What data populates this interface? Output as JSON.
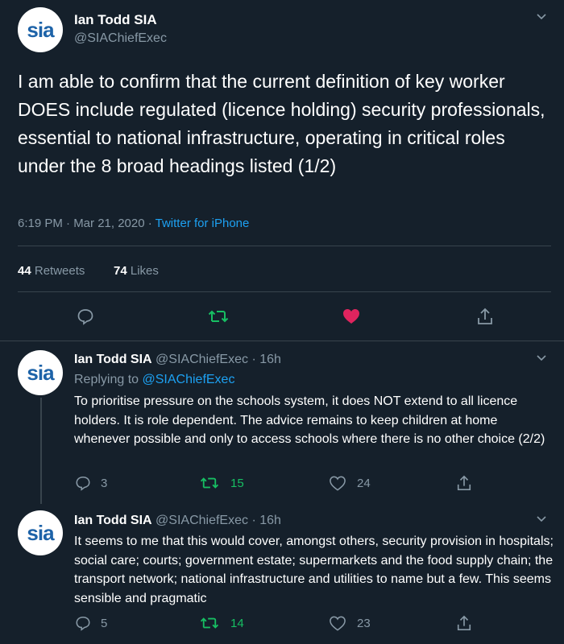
{
  "main_tweet": {
    "author_name": "Ian Todd SIA",
    "handle": "@SIAChiefExec",
    "avatar_text": "sia",
    "text": "I am able to confirm that the current definition of key worker DOES include regulated (licence holding) security professionals, essential to national infrastructure, operating in critical roles under the 8 broad headings listed (1/2)",
    "time": "6:19 PM · Mar 21, 2020 · ",
    "source": "Twitter for iPhone",
    "retweets_count": "44",
    "retweets_label": "Retweets",
    "likes_count": "74",
    "likes_label": "Likes"
  },
  "replies": [
    {
      "author_name": "Ian Todd SIA",
      "handle_time": "@SIAChiefExec · 16h",
      "replying_prefix": "Replying to ",
      "replying_handle": "@SIAChiefExec",
      "text": "To prioritise pressure on the schools system, it does NOT extend to all licence holders. It is role dependent. The advice remains to keep children at home whenever possible and only to access schools where there is no other choice (2/2)",
      "replies": "3",
      "retweets": "15",
      "likes": "24"
    },
    {
      "author_name": "Ian Todd SIA",
      "handle_time": "@SIAChiefExec · 16h",
      "text": "It seems to me that this would cover, amongst others, security provision in hospitals; social care; courts; government estate; supermarkets and the food supply chain; the transport network; national infrastructure and utilities to name but a few. This seems sensible and pragmatic",
      "replies": "5",
      "retweets": "14",
      "likes": "23"
    }
  ],
  "colors": {
    "background": "#15202b",
    "retweet": "#17bf63",
    "like": "#e0245e",
    "link": "#1da1f2",
    "muted": "#8899a6"
  }
}
